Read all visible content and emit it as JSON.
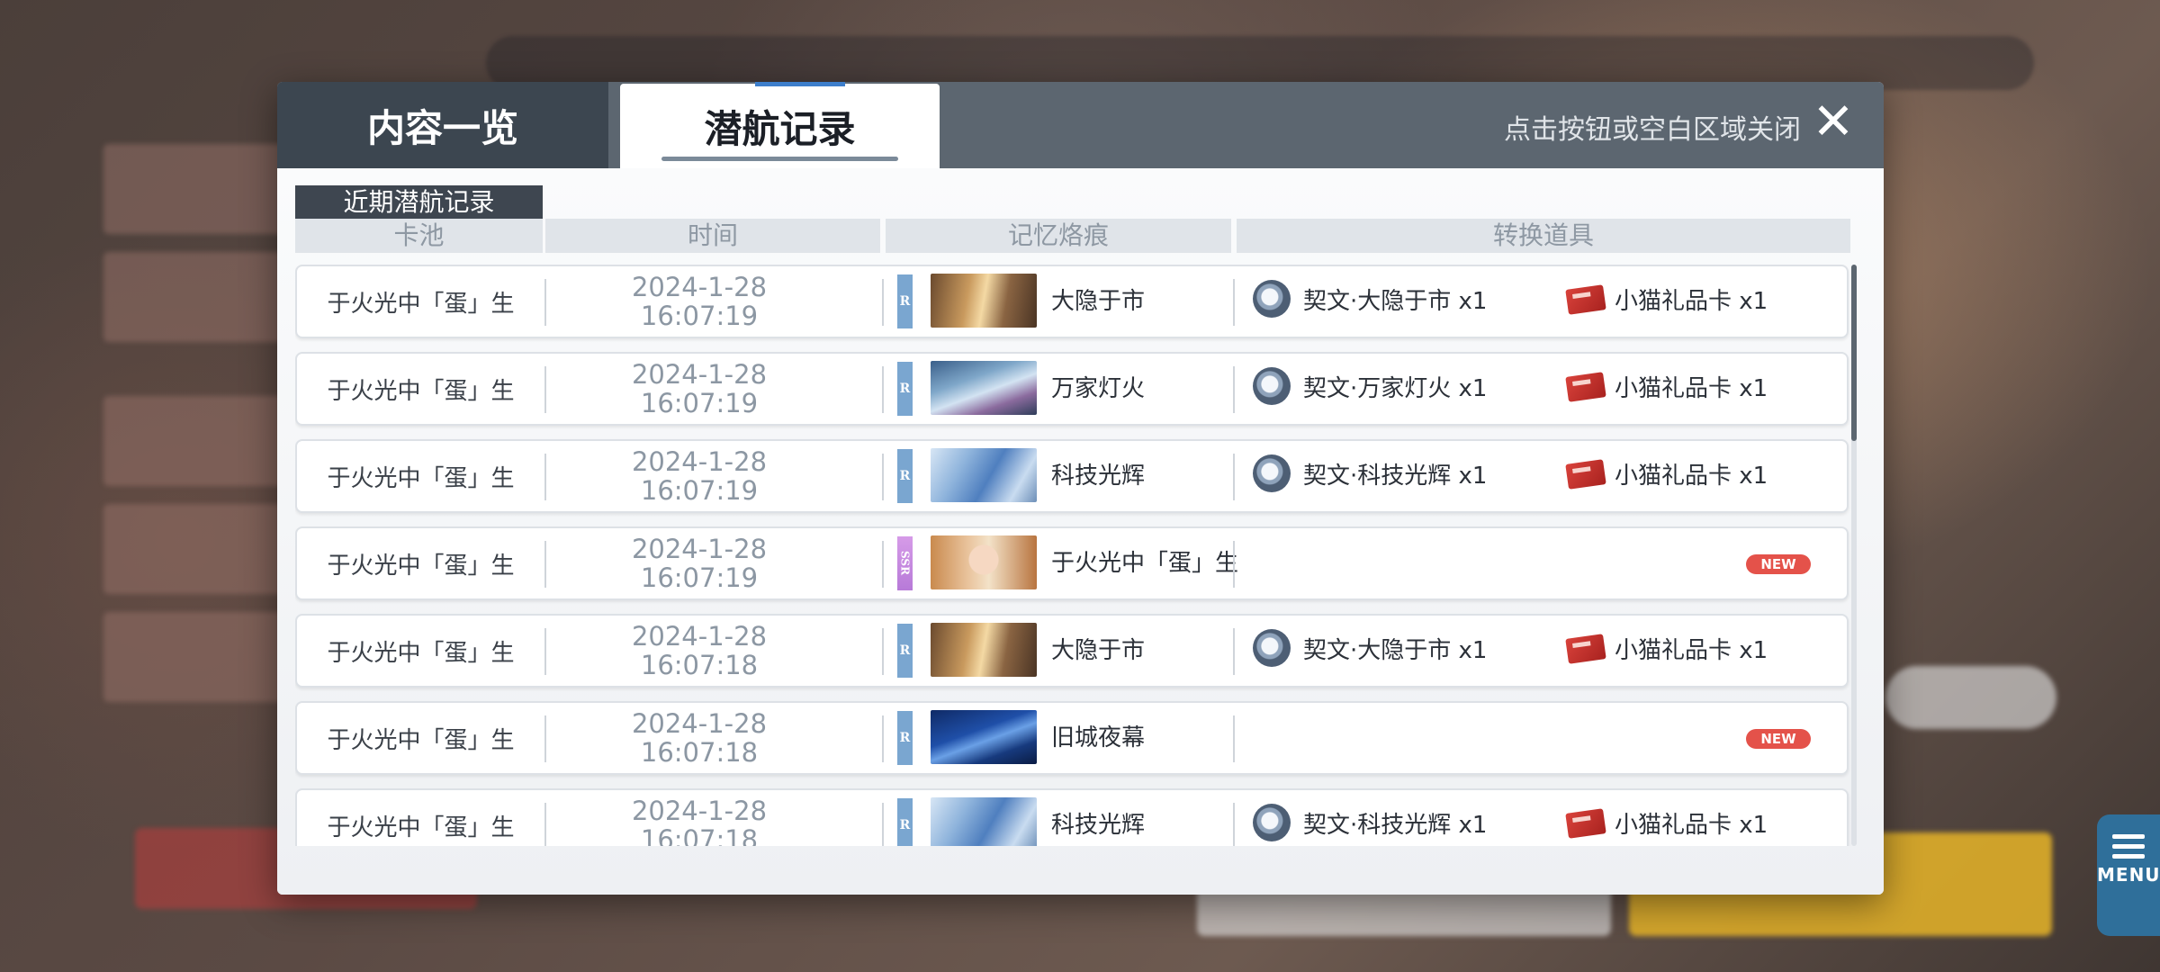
{
  "tabs": [
    {
      "label": "内容一览",
      "active": false
    },
    {
      "label": "潜航记录",
      "active": true
    }
  ],
  "close_hint": "点击按钮或空白区域关闭",
  "close_icon": "close-x-icon",
  "section_title": "近期潜航记录",
  "columns": {
    "pool": "卡池",
    "time": "时间",
    "memory": "记忆烙痕",
    "items": "转换道具"
  },
  "rows": [
    {
      "pool": "于火光中「蛋」生",
      "date": "2024-1-28",
      "time": "16:07:19",
      "rarity": "R",
      "memory": "大隐于市",
      "thumb": "thumb-street",
      "item1": "契文·大隐于市 x1",
      "item2": "小猫礼品卡 x1",
      "new_badge": ""
    },
    {
      "pool": "于火光中「蛋」生",
      "date": "2024-1-28",
      "time": "16:07:19",
      "rarity": "R",
      "memory": "万家灯火",
      "thumb": "thumb-lights",
      "item1": "契文·万家灯火 x1",
      "item2": "小猫礼品卡 x1",
      "new_badge": ""
    },
    {
      "pool": "于火光中「蛋」生",
      "date": "2024-1-28",
      "time": "16:07:19",
      "rarity": "R",
      "memory": "科技光辉",
      "thumb": "thumb-tech",
      "item1": "契文·科技光辉 x1",
      "item2": "小猫礼品卡 x1",
      "new_badge": ""
    },
    {
      "pool": "于火光中「蛋」生",
      "date": "2024-1-28",
      "time": "16:07:19",
      "rarity": "SSR",
      "memory": "于火光中「蛋」生",
      "thumb": "thumb-portrait",
      "item1": "",
      "item2": "",
      "new_badge": "NEW"
    },
    {
      "pool": "于火光中「蛋」生",
      "date": "2024-1-28",
      "time": "16:07:18",
      "rarity": "R",
      "memory": "大隐于市",
      "thumb": "thumb-street",
      "item1": "契文·大隐于市 x1",
      "item2": "小猫礼品卡 x1",
      "new_badge": ""
    },
    {
      "pool": "于火光中「蛋」生",
      "date": "2024-1-28",
      "time": "16:07:18",
      "rarity": "R",
      "memory": "旧城夜幕",
      "thumb": "thumb-night",
      "item1": "",
      "item2": "",
      "new_badge": "NEW"
    },
    {
      "pool": "于火光中「蛋」生",
      "date": "2024-1-28",
      "time": "16:07:18",
      "rarity": "R",
      "memory": "科技光辉",
      "thumb": "thumb-tech",
      "item1": "契文·科技光辉 x1",
      "item2": "小猫礼品卡 x1",
      "new_badge": ""
    }
  ],
  "background": {
    "menu_label": "MENU"
  },
  "colors": {
    "header": "#5c6670",
    "active_tab_accent": "#3d7ecb",
    "rarity_R": "#7aa6d0",
    "rarity_SSR": "#c98be0",
    "new_badge": "#e4524a"
  }
}
